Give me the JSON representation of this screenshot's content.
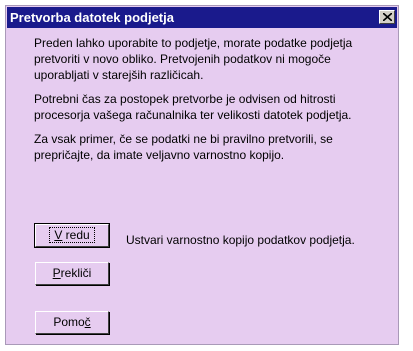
{
  "dialog": {
    "title": "Pretvorba datotek podjetja",
    "paragraphs": [
      [
        "Preden lahko uporabite to podjetje, morate podatke podjetja",
        "pretvoriti v novo obliko. Pretvojenih podatkov ni mogoče",
        "uporabljati v starejših različicah."
      ],
      [
        "Potrebni čas za postopek pretvorbe je odvisen od hitrosti",
        "procesorja vašega računalnika ter velikosti datotek podjetja."
      ],
      [
        "Za vsak primer, če se podatki ne bi pravilno pretvorili, se",
        "prepričajte, da imate veljavno varnostno kopijo."
      ]
    ],
    "buttons": {
      "ok": {
        "mnemonic": "V",
        "rest": " redu"
      },
      "cancel": {
        "mnemonic": "P",
        "rest": "rekliči"
      },
      "help": {
        "pre": "Pomo",
        "mnemonic": "č"
      }
    },
    "ok_hint": "Ustvari varnostno kopijo podatkov podjetja."
  },
  "colors": {
    "titlebar": "#1a1a8c",
    "dialog_bg": "#e6ccf0"
  },
  "icons": {
    "close": "close-icon"
  }
}
